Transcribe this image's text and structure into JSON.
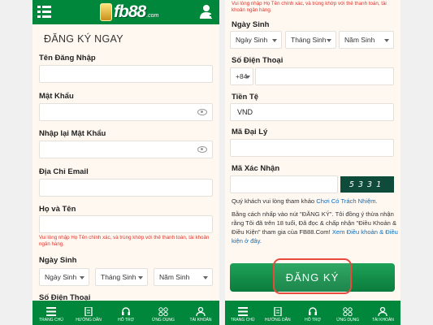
{
  "brand": {
    "logo_text": "fb88",
    "logo_suffix": ".com"
  },
  "left": {
    "title": "ĐĂNG KÝ NGAY",
    "username_label": "Tên Đăng Nhập",
    "password_label": "Mật Khẩu",
    "password_confirm_label": "Nhập lại Mật Khẩu",
    "email_label": "Địa Chỉ Email",
    "fullname_label": "Họ và Tên",
    "fullname_error": "Vui lòng nhập Họ Tên chính xác, và trùng khớp với thẻ thanh toán, tài khoản ngân hàng.",
    "dob_label": "Ngày Sinh",
    "dob_day": "Ngày Sinh",
    "dob_month": "Tháng Sinh",
    "dob_year": "Năm Sinh",
    "phone_label_partial": "Số Điện Thoại"
  },
  "right": {
    "top_error": "Vui lòng nhập Họ Tên chính xác, và trùng khớp với thẻ thanh toán, tài khoản ngân hàng.",
    "dob_label": "Ngày Sinh",
    "dob_day": "Ngày Sinh",
    "dob_month": "Tháng Sinh",
    "dob_year": "Năm Sinh",
    "phone_label": "Số Điện Thoại",
    "phone_prefix": "+84",
    "currency_label": "Tiền Tệ",
    "currency_value": "VND",
    "agent_label": "Mã Đại Lý",
    "captcha_label": "Mã Xác Nhận",
    "captcha_code": "5331",
    "policy_text": "Quý khách vui lòng tham khảo",
    "policy_link": "Chơi Có Trách Nhiệm.",
    "terms_text": "Bằng cách nhấp vào nút \"ĐĂNG KÝ\". Tôi đồng ý thừa nhận rằng Tôi đã trên 18 tuổi, Đã đọc & chấp nhận \"Điều Khoản & Điều Kiện\" tham gia của FB88.Com!",
    "terms_link": "Xem Điều khoản & Điều kiện ở đây.",
    "register_label": "ĐĂNG KÝ"
  },
  "nav": [
    {
      "label": "TRANG CHỦ",
      "icon": "home-icon"
    },
    {
      "label": "HƯỚNG DẪN",
      "icon": "guide-icon"
    },
    {
      "label": "HỖ TRỢ",
      "icon": "headset-icon"
    },
    {
      "label": "ỨNG DỤNG",
      "icon": "apps-icon"
    },
    {
      "label": "TÀI KHOẢN",
      "icon": "account-icon"
    }
  ],
  "colors": {
    "brand_green": "#00873c",
    "error_red": "#e2312a",
    "link_blue": "#0a6fc2",
    "highlight": "#e84a3c"
  }
}
